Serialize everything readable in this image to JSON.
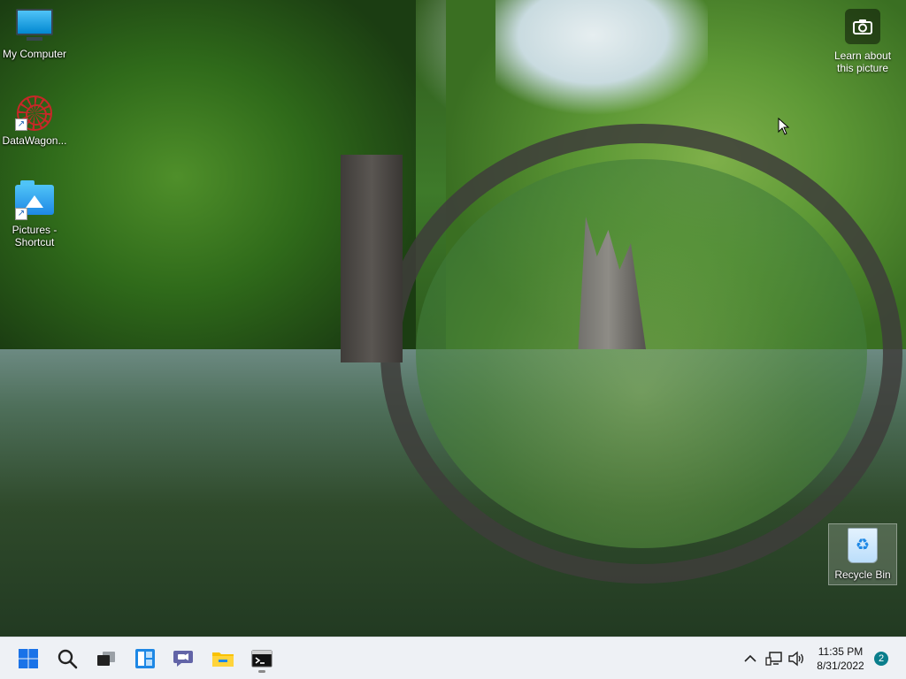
{
  "desktop": {
    "icons": [
      {
        "label": "My Computer",
        "icon": "monitor-icon"
      },
      {
        "label": "DataWagon...",
        "icon": "datawagon-web-icon"
      },
      {
        "label": "Pictures - Shortcut",
        "icon": "pictures-folder-icon"
      }
    ],
    "recycle_bin": {
      "label": "Recycle Bin",
      "icon": "recycle-bin-icon"
    },
    "learn_picture": {
      "label": "Learn about this picture",
      "icon": "camera-icon"
    }
  },
  "taskbar": {
    "apps": [
      {
        "name": "start",
        "icon": "windows-start-icon",
        "accent": "#1a73e8"
      },
      {
        "name": "search",
        "icon": "search-icon"
      },
      {
        "name": "task-view",
        "icon": "task-view-icon"
      },
      {
        "name": "widgets",
        "icon": "widgets-icon",
        "accent": "#1e88e5"
      },
      {
        "name": "chat",
        "icon": "teams-chat-icon",
        "accent": "#6264a7"
      },
      {
        "name": "file-explorer",
        "icon": "folder-icon",
        "accent": "#f9c200"
      },
      {
        "name": "terminal",
        "icon": "terminal-icon",
        "active": true
      }
    ],
    "tray": {
      "chevron_icon": "chevron-up-icon",
      "network_icon": "network-icon",
      "volume_icon": "volume-icon",
      "time": "11:35 PM",
      "date": "8/31/2022",
      "notifications": "2"
    }
  }
}
